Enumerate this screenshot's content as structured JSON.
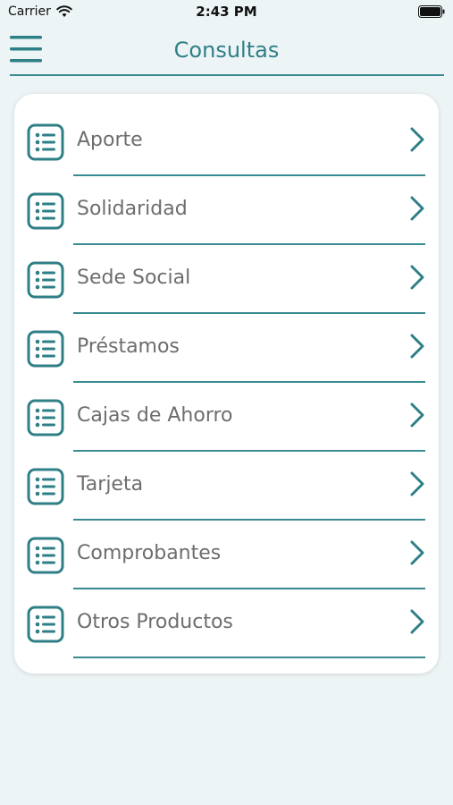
{
  "status_bar": {
    "carrier": "Carrier",
    "time": "2:43 PM",
    "wifi_icon": "wifi-icon",
    "battery_icon": "battery-icon"
  },
  "header": {
    "title": "Consultas",
    "menu_icon": "hamburger-menu-icon"
  },
  "colors": {
    "accent": "#2f7f86",
    "divider": "#3a8a91",
    "background": "#edf4f6",
    "label": "#6d6d6d"
  },
  "menu": {
    "items": [
      {
        "label": "Aporte",
        "icon": "list-icon"
      },
      {
        "label": "Solidaridad",
        "icon": "list-icon"
      },
      {
        "label": "Sede Social",
        "icon": "list-icon"
      },
      {
        "label": "Préstamos",
        "icon": "list-icon"
      },
      {
        "label": "Cajas de Ahorro",
        "icon": "list-icon"
      },
      {
        "label": "Tarjeta",
        "icon": "list-icon"
      },
      {
        "label": "Comprobantes",
        "icon": "list-icon"
      },
      {
        "label": "Otros Productos",
        "icon": "list-icon"
      }
    ]
  }
}
